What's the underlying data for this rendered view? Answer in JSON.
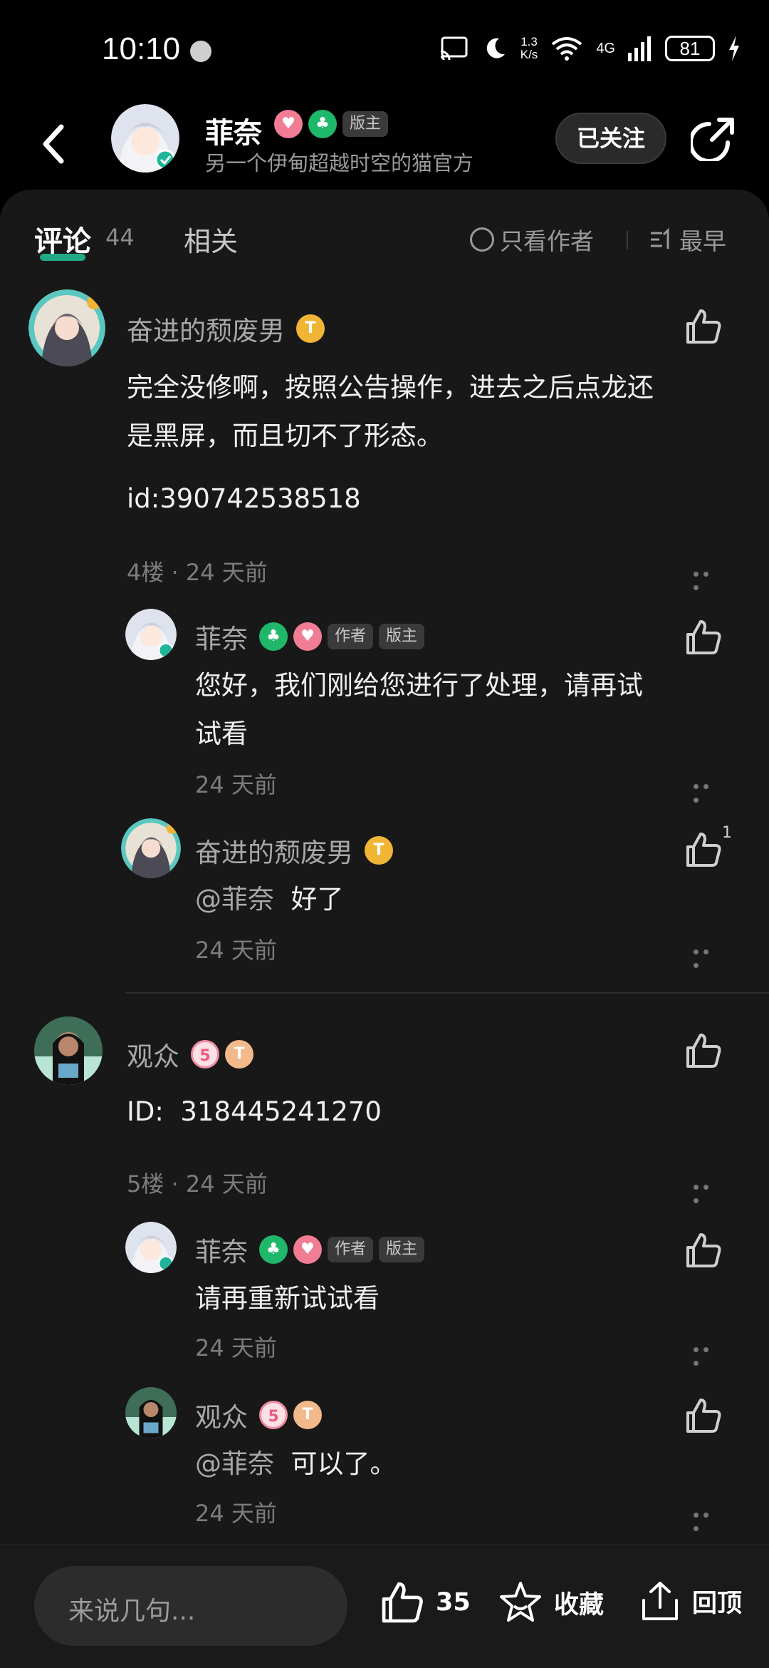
{
  "status": {
    "time": "10:10",
    "speed_value": "1.3",
    "speed_unit": "K/s",
    "network": "4G",
    "battery": "81"
  },
  "header": {
    "name": "菲奈",
    "role_badge": "版主",
    "subtitle": "另一个伊甸超越时空的猫官方",
    "follow_label": "已关注"
  },
  "tabs": {
    "comments_label": "评论",
    "comments_count": "44",
    "related_label": "相关",
    "author_only_label": "只看作者",
    "sort_label": "最早"
  },
  "comments": [
    {
      "author": "奋进的颓废男",
      "text_line1": "完全没修啊，按照公告操作，进去之后点龙还",
      "text_line2": "是黑屏，而且切不了形态。",
      "text_id": "id:390742538518",
      "meta": "4楼 · 24 天前",
      "replies": [
        {
          "author": "菲奈",
          "tag_author": "作者",
          "tag_mod": "版主",
          "text_line1": "您好，我们刚给您进行了处理，请再试",
          "text_line2": "试看",
          "time": "24 天前"
        },
        {
          "author": "奋进的颓废男",
          "mention": "@菲奈",
          "text": "好了",
          "time": "24 天前",
          "likes": "1"
        }
      ]
    },
    {
      "author": "观众",
      "text_id_label": "ID:",
      "text_id_value": "318445241270",
      "meta": "5楼 · 24 天前",
      "replies": [
        {
          "author": "菲奈",
          "tag_author": "作者",
          "tag_mod": "版主",
          "text": "请再重新试试看",
          "time": "24 天前"
        },
        {
          "author": "观众",
          "mention": "@菲奈",
          "text": "可以了。",
          "time": "24 天前"
        }
      ]
    }
  ],
  "bottom": {
    "input_placeholder": "来说几句...",
    "like_count": "35",
    "favorite_label": "收藏",
    "reply_label": "回顶"
  }
}
